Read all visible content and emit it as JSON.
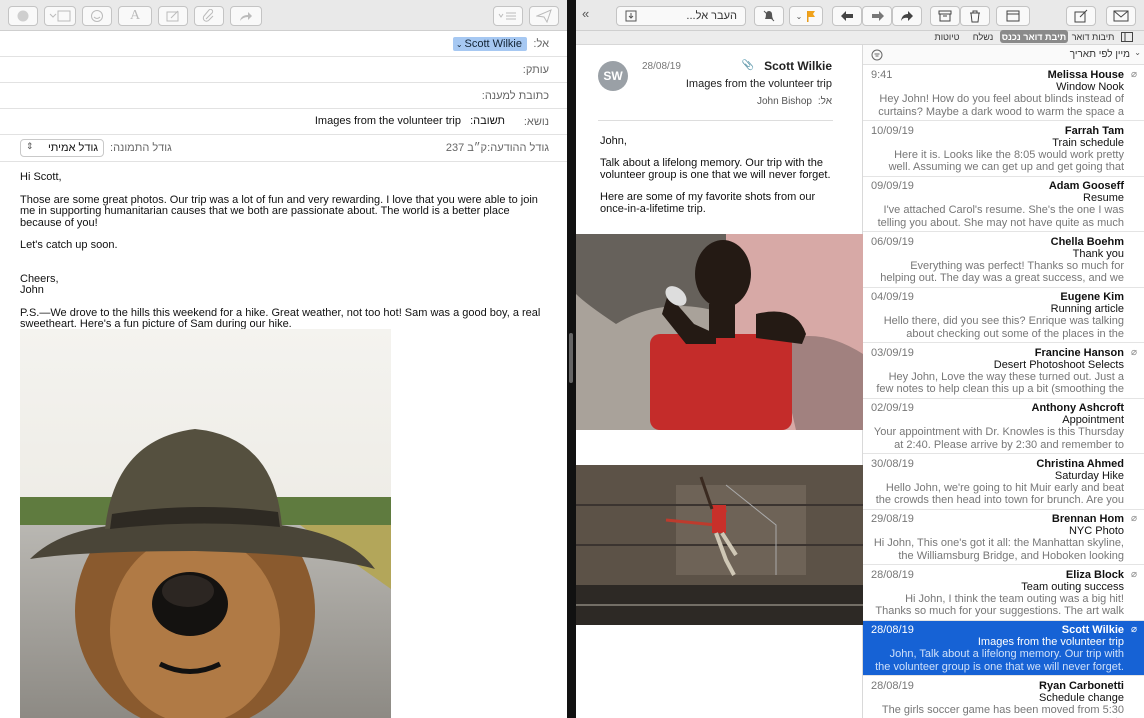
{
  "compose": {
    "to_label": ":אל",
    "to_token": "Scott Wilkie",
    "cc_label": ":עותק",
    "reply_to_label": ":כתובת למענה",
    "subject_label": ":נושא",
    "subject_prefix": ":תשובה",
    "subject_value": "Images from the volunteer trip",
    "message_size_label": ":גודל ההודעה",
    "message_size_value": "237 ק״ב",
    "image_size_label": ":גודל התמונה",
    "image_size_value": "גודל אמיתי",
    "body": {
      "greeting": "Hi Scott,",
      "para1": "Those are some great photos. Our trip was a lot of fun and very rewarding. I love that you were able to join me in supporting humanitarian causes that we both are passionate about. The world is a better place because of you!",
      "para2": "Let's catch up soon.",
      "closing": "Cheers,",
      "name": "John",
      "ps": "P.S.—We drove to the hills this weekend for a hike. Great weather, not too hot! Sam was a good boy, a real sweetheart. Here's a fun picture of Sam during our hike."
    }
  },
  "mail": {
    "move_to_placeholder": "...העבר אל",
    "tabs": {
      "mailboxes": "תיבות דואר",
      "inbox": "תיבת דואר נכנס",
      "sent": "נשלח",
      "drafts": "טיוטות"
    },
    "sort_label": "מיין לפי תאריך",
    "message": {
      "avatar": "SW",
      "sender": "Scott Wilkie",
      "date": "28/08/19",
      "subject": "Images from the volunteer trip",
      "to_label": ":אל",
      "to": "John Bishop",
      "line1": "John,",
      "line2": "Talk about a lifelong memory. Our trip with the volunteer group is one that we will never forget.",
      "line3": "Here are some of my favorite shots from our once-in-a-lifetime trip."
    },
    "list": [
      {
        "sender": "Melissa House",
        "date": "9:41",
        "subject": "Window Nook",
        "preview": "Hey John! How do you feel about blinds instead of curtains? Maybe a dark wood to warm the space a bit. W...",
        "attach": true
      },
      {
        "sender": "Farrah Tam",
        "date": "10/09/19",
        "subject": "Train schedule",
        "preview": "Here it is. Looks like the 8:05 would work pretty well. Assuming we can get up and get going that early.",
        "attach": false
      },
      {
        "sender": "Adam Gooseff",
        "date": "09/09/19",
        "subject": "Resume",
        "preview": "I've attached Carol's resume. She's the one I was telling you about. She may not have quite as much experience...",
        "attach": false
      },
      {
        "sender": "Chella Boehm",
        "date": "06/09/19",
        "subject": "Thank you",
        "preview": "Everything was perfect! Thanks so much for helping out. The day was a great success, and we couldn't have don...",
        "attach": false
      },
      {
        "sender": "Eugene Kim",
        "date": "04/09/19",
        "subject": "Running article",
        "preview": "Hello there, did you see this? Enrique was talking about checking out some of the places in the article.",
        "attach": false
      },
      {
        "sender": "Francine Hanson",
        "date": "03/09/19",
        "subject": "Desert Photoshoot Selects",
        "preview": "Hey John, Love the way these turned out. Just a few notes to help clean this up a bit (smoothing the hair, rem...",
        "attach": true
      },
      {
        "sender": "Anthony Ashcroft",
        "date": "02/09/19",
        "subject": "Appointment",
        "preview": "Your appointment with Dr. Knowles is this Thursday at 2:40. Please arrive by 2:30 and remember to bring your i...",
        "attach": false
      },
      {
        "sender": "Christina Ahmed",
        "date": "30/08/19",
        "subject": "Saturday Hike",
        "preview": "Hello John, we're going to hit Muir early and beat the crowds then head into town for brunch. Are you still free...",
        "attach": false
      },
      {
        "sender": "Brennan Hom",
        "date": "29/08/19",
        "subject": "NYC Photo",
        "preview": "Hi John, This one's got it all: the Manhattan skyline, the Williamsburg Bridge, and Hoboken looking seriously cool...",
        "attach": true
      },
      {
        "sender": "Eliza Block",
        "date": "28/08/19",
        "subject": "Team outing success",
        "preview": "Hi John, I think the team outing was a big hit! Thanks so much for your suggestions. The art walk was a great ide...",
        "attach": true
      },
      {
        "sender": "Scott Wilkie",
        "date": "28/08/19",
        "subject": "Images from the volunteer trip",
        "preview": "John, Talk about a lifelong memory. Our trip with the volunteer group is one that we will never forget. Here are...",
        "attach": true,
        "selected": true
      },
      {
        "sender": "Ryan Carbonetti",
        "date": "28/08/19",
        "subject": "Schedule change",
        "preview": "The girls soccer game has been moved from 5:30 to",
        "attach": false
      }
    ]
  }
}
